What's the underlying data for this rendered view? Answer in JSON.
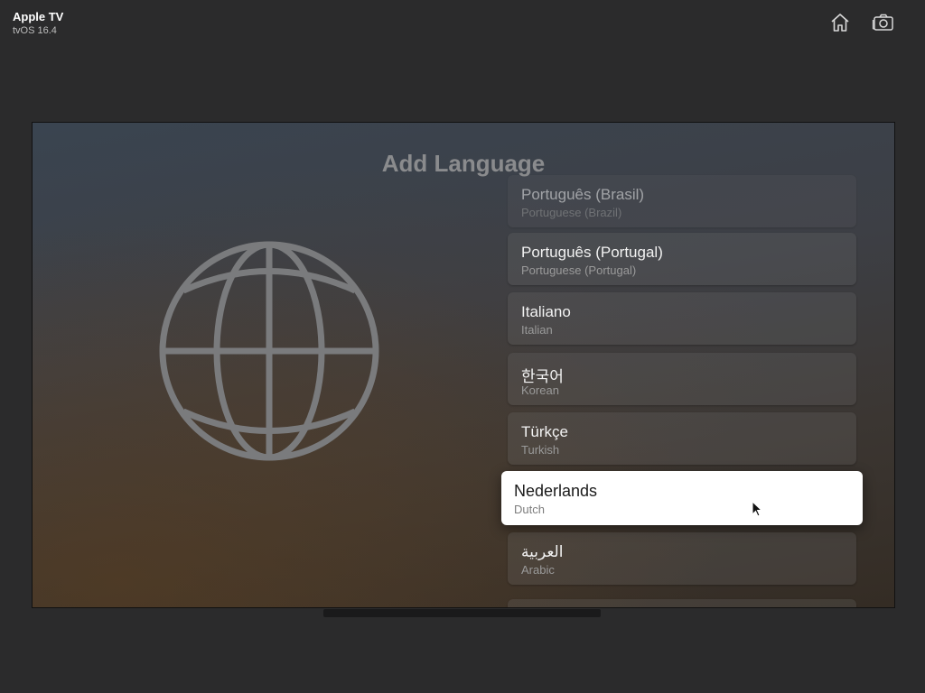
{
  "device": {
    "name": "Apple TV",
    "os": "tvOS 16.4"
  },
  "toolbar": {
    "home_icon": "home-icon",
    "screenshot_icon": "camera-icon"
  },
  "screen": {
    "title": "Add Language",
    "globe_icon": "globe-icon",
    "languages": [
      {
        "name": "Português (Brasil)",
        "english": "Portuguese (Brazil)"
      },
      {
        "name": "Português (Portugal)",
        "english": "Portuguese (Portugal)"
      },
      {
        "name": "Italiano",
        "english": "Italian"
      },
      {
        "name": "한국어",
        "english": "Korean"
      },
      {
        "name": "Türkçe",
        "english": "Turkish"
      },
      {
        "name": "Nederlands",
        "english": "Dutch"
      },
      {
        "name": "العربية",
        "english": "Arabic"
      }
    ],
    "focused_index": 5
  }
}
